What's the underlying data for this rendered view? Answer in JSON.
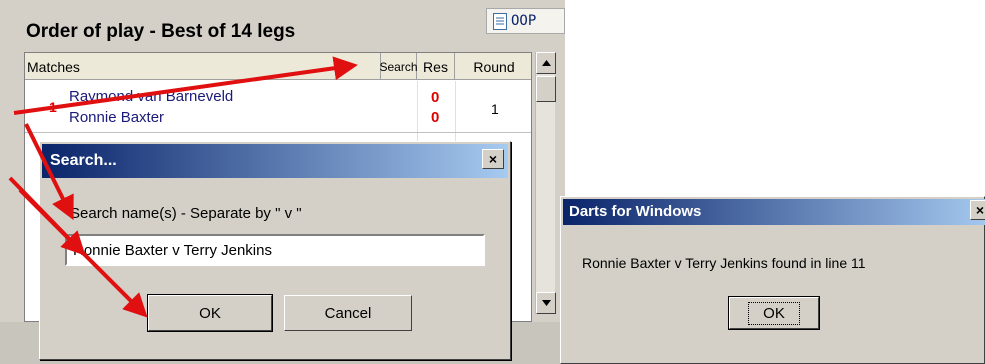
{
  "main": {
    "title": "Order of play - Best of 14 legs",
    "oop_button": "OOP",
    "grid": {
      "headers": {
        "matches": "Matches",
        "search": "Search",
        "res": "Res",
        "round": "Round"
      },
      "row": {
        "number": "1",
        "player1": "Raymond van Barneveld",
        "player2": "Ronnie Baxter",
        "res1": "0",
        "res2": "0",
        "round": "1"
      }
    }
  },
  "search_dialog": {
    "title": "Search...",
    "close": "×",
    "prompt": "Search name(s) - Separate by \" v \"",
    "input_value": "Ronnie Baxter v Terry Jenkins",
    "ok": "OK",
    "cancel": "Cancel"
  },
  "message_box": {
    "title": "Darts for Windows",
    "close": "×",
    "text": "Ronnie Baxter v Terry Jenkins found in line 11",
    "ok": "OK"
  },
  "colors": {
    "title_bar_start": "#0a246a",
    "title_bar_end": "#a6caf0",
    "arrow": "#e01010",
    "result": "#e00000"
  }
}
